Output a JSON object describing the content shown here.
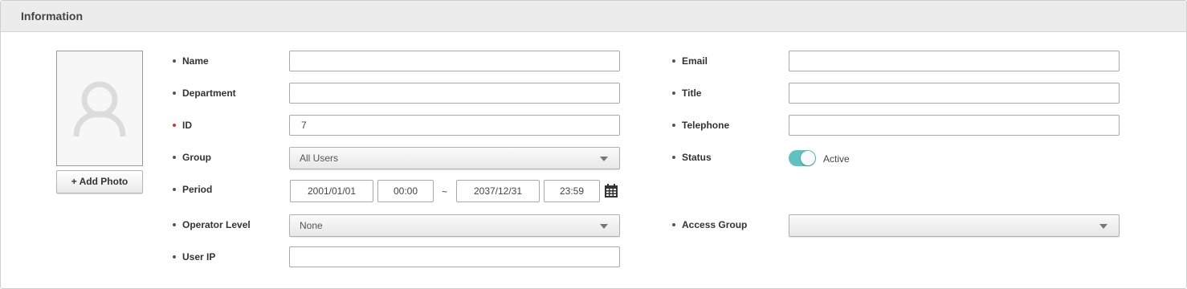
{
  "panel": {
    "title": "Information"
  },
  "photo": {
    "add_label": "+ Add Photo"
  },
  "fields": {
    "name": {
      "label": "Name",
      "value": ""
    },
    "department": {
      "label": "Department",
      "value": ""
    },
    "id": {
      "label": "ID",
      "value": "7",
      "required": true
    },
    "group": {
      "label": "Group",
      "value": "All Users"
    },
    "period": {
      "label": "Period",
      "start_date": "2001/01/01",
      "start_time": "00:00",
      "separator": "~",
      "end_date": "2037/12/31",
      "end_time": "23:59"
    },
    "operator_level": {
      "label": "Operator Level",
      "value": "None"
    },
    "user_ip": {
      "label": "User IP",
      "value": ""
    },
    "email": {
      "label": "Email",
      "value": ""
    },
    "title": {
      "label": "Title",
      "value": ""
    },
    "telephone": {
      "label": "Telephone",
      "value": ""
    },
    "status": {
      "label": "Status",
      "value": "Active",
      "on": true
    },
    "access_group": {
      "label": "Access Group",
      "value": ""
    }
  },
  "colors": {
    "toggle_on": "#5ec2c0",
    "required_bullet": "#e03030",
    "header_bg": "#ececec"
  },
  "icons": {
    "avatar": "user-silhouette",
    "calendar": "calendar-icon",
    "dropdown": "chevron-down"
  }
}
